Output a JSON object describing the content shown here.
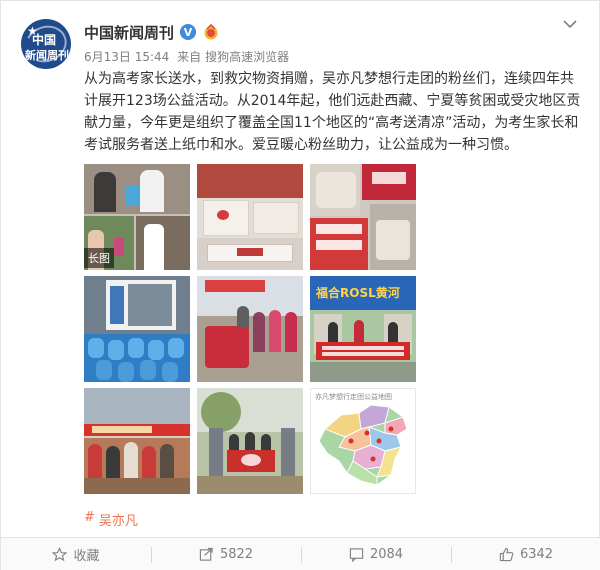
{
  "post": {
    "author": "中国新闻周刊",
    "avatar_line1": "中国",
    "avatar_line2": "新闻周刊",
    "verified_mark": "V",
    "date": "6月13日 15:44",
    "source_prefix": "来自",
    "source": "搜狗高速浏览器",
    "text": "从为高考家长送水，到救灾物资捐赠，吴亦凡梦想行走团的粉丝们，连续四年共计展开123场公益活动。从2014年起，他们远赴西藏、宁夏等贫困或受灾地区贡献力量，今年更是组织了覆盖全国11个地区的“高考送清凉”活动，为考生家长和考试服务者送上纸巾和水。爱豆暖心粉丝助力，让公益成为一种习惯。",
    "hashtag_symbol": "#",
    "hashtag": "吴亦凡"
  },
  "photos": {
    "long_image_tag": "长图",
    "banner_text_6": "福合ROSL黄河",
    "banner_text_5": "教育、有爱",
    "watermark_9": "亦凡梦想行走团公益地图"
  },
  "actions": {
    "favorite_label": "收藏",
    "repost_count": "5822",
    "comment_count": "2084",
    "like_count": "6342"
  },
  "colors": {
    "accent": "#eb7350",
    "verify": "#3f8bdc",
    "text": "#333333",
    "meta": "#808080"
  }
}
